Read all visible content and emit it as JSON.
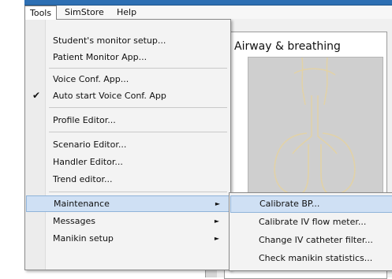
{
  "menubar": {
    "items": [
      "Tools",
      "SimStore",
      "Help"
    ],
    "active": "Tools"
  },
  "tools_menu": {
    "items": [
      {
        "label": "Student's monitor setup..."
      },
      {
        "label": "Patient Monitor App..."
      },
      {
        "label": "Voice Conf. App..."
      },
      {
        "label": "Auto start Voice Conf. App",
        "checked": true
      },
      {
        "label": "Profile Editor..."
      },
      {
        "label": "Scenario Editor..."
      },
      {
        "label": "Handler Editor..."
      },
      {
        "label": "Trend editor..."
      },
      {
        "label": "Maintenance",
        "submenu": true,
        "highlighted": true
      },
      {
        "label": "Messages",
        "submenu": true
      },
      {
        "label": "Manikin setup",
        "submenu": true
      }
    ]
  },
  "maintenance_submenu": {
    "items": [
      {
        "label": "Calibrate BP...",
        "highlighted": true
      },
      {
        "label": "Calibrate IV flow meter..."
      },
      {
        "label": "Change IV catheter filter..."
      },
      {
        "label": "Check manikin statistics..."
      }
    ]
  },
  "airway_panel": {
    "title": "Airway & breathing"
  },
  "colors": {
    "title_bar": "#2d6fb3",
    "highlight": "#cfe0f4",
    "highlight_border": "#8fb3d9",
    "menu_bg": "#f3f3f3"
  },
  "icons": {
    "check": "check-icon",
    "submenu_arrow": "submenu-arrow-icon"
  }
}
